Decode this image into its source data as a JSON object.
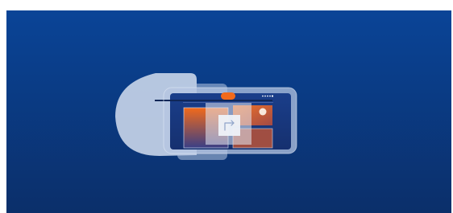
{
  "illustration": {
    "background_gradient": [
      "#0a3f95",
      "#0b2e6b"
    ],
    "accent_orange": "#f26a1b",
    "glass_color": "#c9d6ea",
    "arrow_icon": "arrow-corner-right-icon"
  }
}
